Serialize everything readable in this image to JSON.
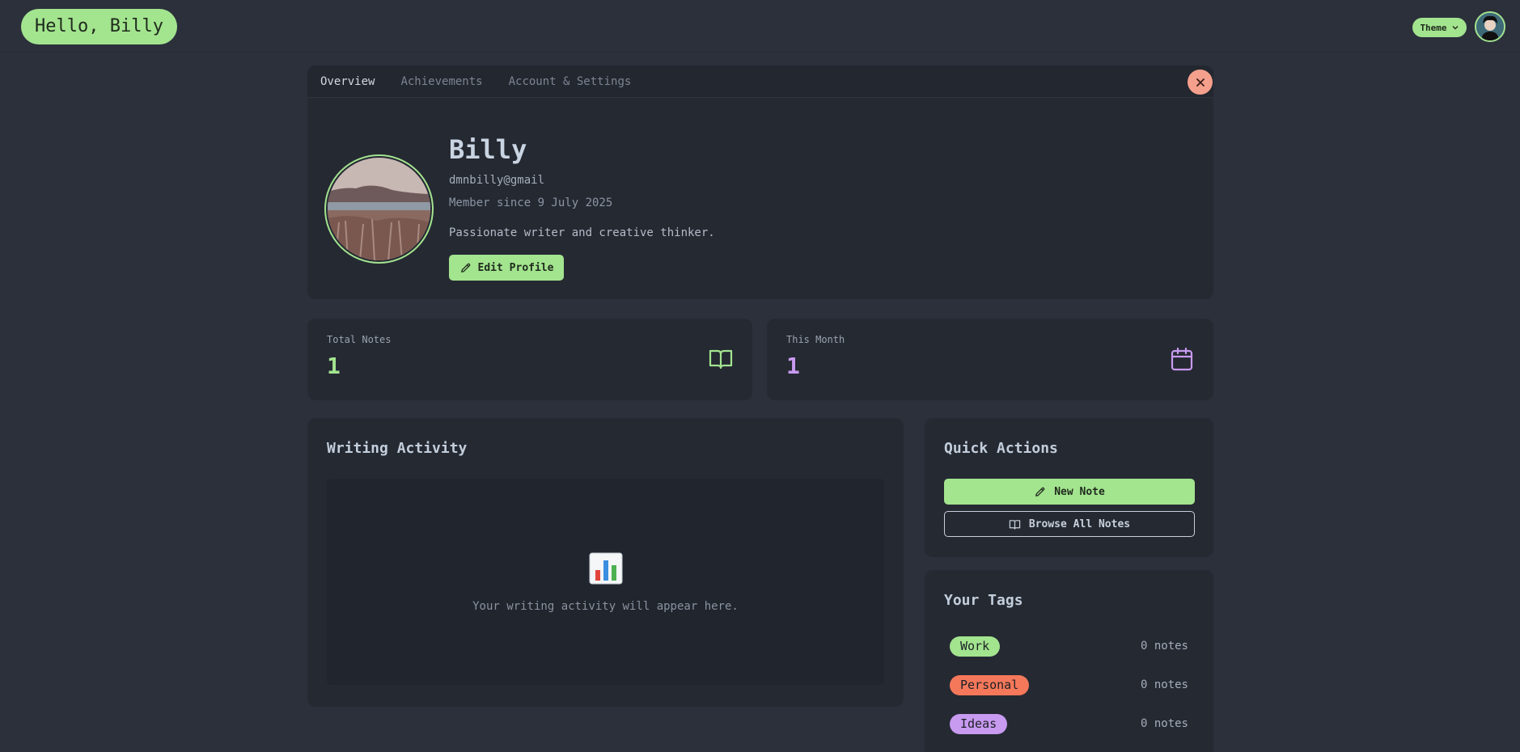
{
  "header": {
    "greeting": "Hello, Billy",
    "theme_label": "Theme"
  },
  "tabs": [
    {
      "label": "Overview",
      "active": true
    },
    {
      "label": "Achievements",
      "active": false
    },
    {
      "label": "Account & Settings",
      "active": false
    }
  ],
  "profile": {
    "name": "Billy",
    "email": "dmnbilly@gmail",
    "member_since": "Member since 9 July 2025",
    "bio": "Passionate writer and creative thinker.",
    "edit_label": "Edit Profile"
  },
  "stats": {
    "total_notes": {
      "label": "Total Notes",
      "value": "1",
      "color": "#a3e48f",
      "icon": "book-open-icon"
    },
    "this_month": {
      "label": "This Month",
      "value": "1",
      "color": "#c89af0",
      "icon": "calendar-icon"
    }
  },
  "activity": {
    "title": "Writing Activity",
    "empty_text": "Your writing activity will appear here.",
    "icon": "bar-chart-emoji"
  },
  "quick_actions": {
    "title": "Quick Actions",
    "new_note_label": "New Note",
    "browse_label": "Browse All Notes"
  },
  "tags": {
    "title": "Your Tags",
    "items": [
      {
        "name": "Work",
        "count": "0 notes",
        "color": "#a3e48f"
      },
      {
        "name": "Personal",
        "count": "0 notes",
        "color": "#f5785a"
      },
      {
        "name": "Ideas",
        "count": "0 notes",
        "color": "#c89af0"
      }
    ]
  },
  "colors": {
    "accent": "#a3e48f",
    "background": "#2b303b",
    "card": "#252932",
    "close": "#f5a08c"
  }
}
